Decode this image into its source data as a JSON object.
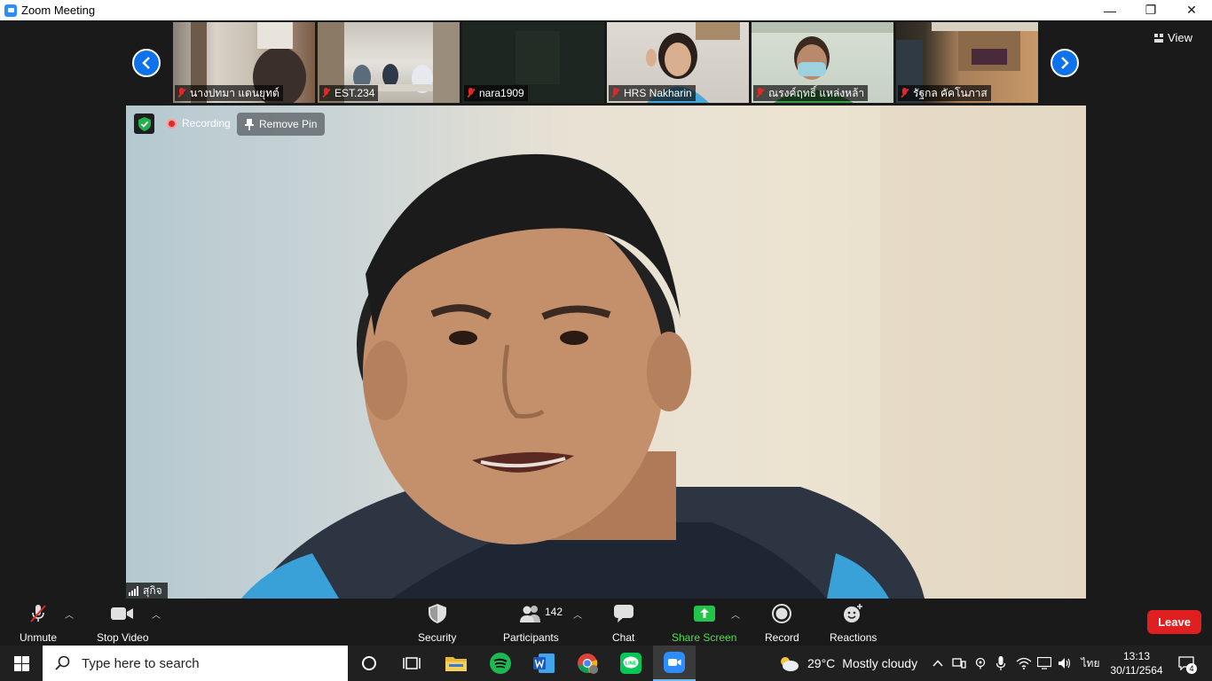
{
  "window": {
    "title": "Zoom Meeting"
  },
  "window_controls": {
    "minimize": "—",
    "restore": "❐",
    "close": "✕"
  },
  "strip": {
    "view_label": "View",
    "thumbnails": [
      {
        "name": "นางปทมา แดนยุทต์",
        "muted": true
      },
      {
        "name": "EST.234",
        "muted": true
      },
      {
        "name": "nara1909",
        "muted": true
      },
      {
        "name": "HRS Nakharin",
        "muted": true
      },
      {
        "name": "ณรงค์ฤทธิ์ แหล่งหล้า",
        "muted": true
      },
      {
        "name": "รัฐกล คัคโนภาส",
        "muted": true
      }
    ]
  },
  "main_video": {
    "recording_label": "Recording",
    "remove_pin_label": "Remove Pin",
    "speaker_name": "สุกิจ"
  },
  "toolbar": {
    "unmute": "Unmute",
    "stop_video": "Stop Video",
    "security": "Security",
    "participants": "Participants",
    "participants_count": "142",
    "chat": "Chat",
    "share_screen": "Share Screen",
    "record": "Record",
    "reactions": "Reactions",
    "leave": "Leave"
  },
  "taskbar": {
    "search_placeholder": "Type here to search",
    "weather_temp": "29°C",
    "weather_desc": "Mostly cloudy",
    "language": "ไทย",
    "time": "13:13",
    "date": "30/11/2564",
    "notification_count": "4"
  },
  "colors": {
    "accent_blue": "#0e72ed",
    "leave_red": "#e02020",
    "share_green": "#4be04b",
    "muted_red": "#e02828"
  }
}
